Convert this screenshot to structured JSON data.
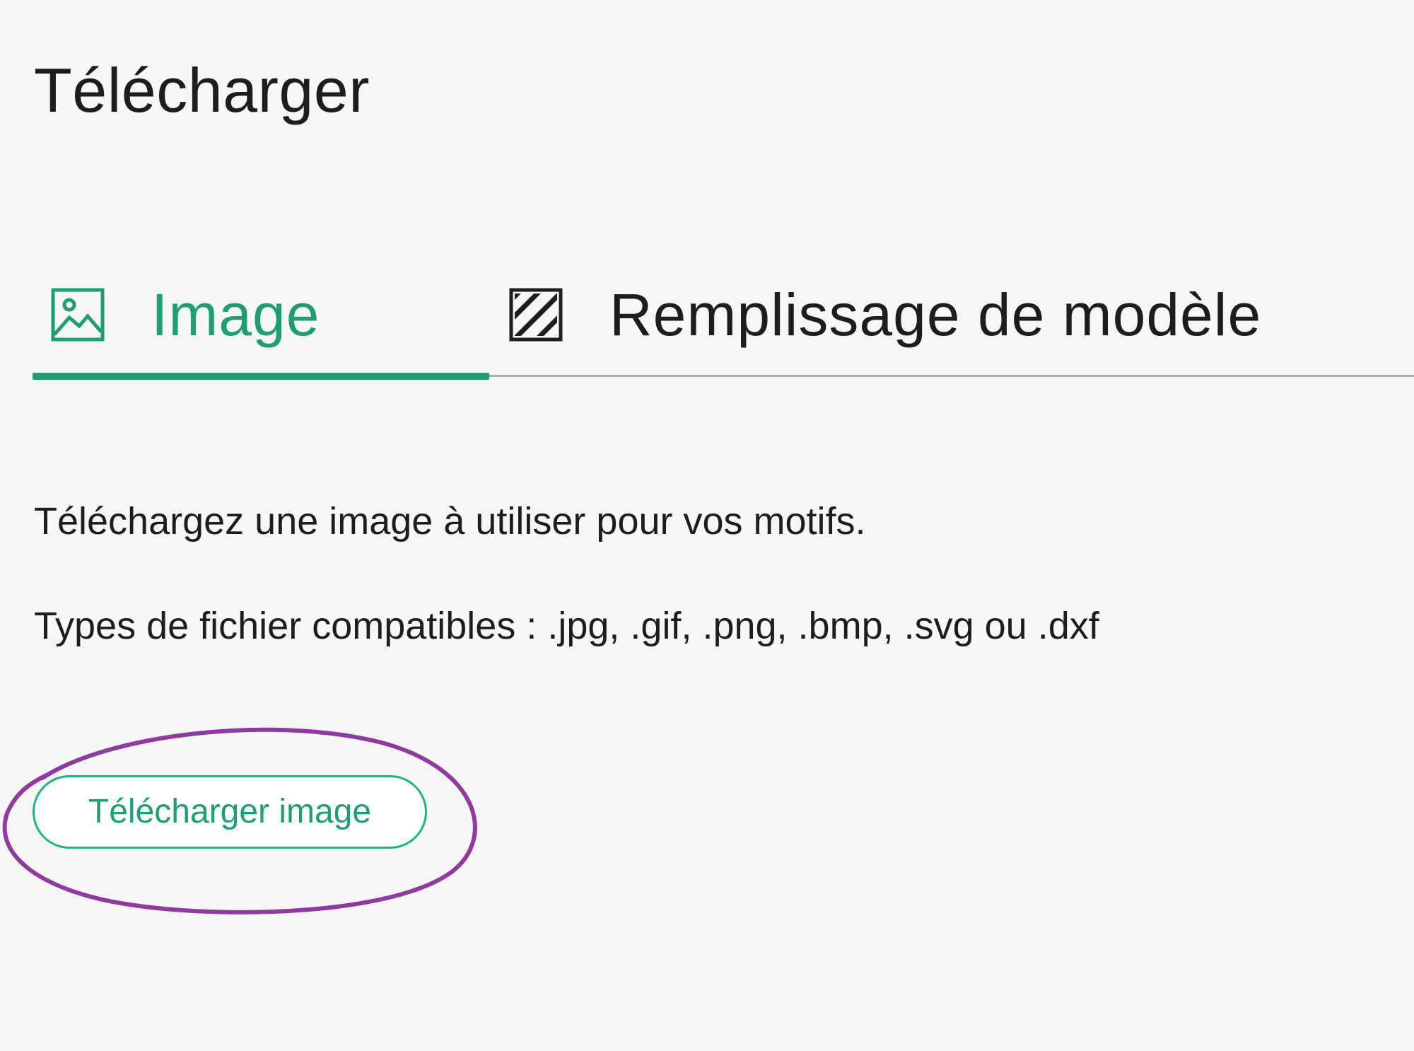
{
  "header": {
    "title": "Télécharger"
  },
  "tabs": [
    {
      "label": "Image",
      "icon": "image-icon",
      "active": true
    },
    {
      "label": "Remplissage de modèle",
      "icon": "pattern-fill-icon",
      "active": false
    }
  ],
  "content": {
    "description": "Téléchargez une image à utiliser pour vos motifs.",
    "file_types": "Types de fichier compatibles : .jpg, .gif, .png, .bmp, .svg ou .dxf",
    "upload_button_label": "Télécharger image"
  },
  "colors": {
    "accent": "#1f9e73",
    "button_border": "#1fb485",
    "annotation": "#8e3a9e",
    "background": "#f6f6f6",
    "text": "#1d1d1d"
  }
}
